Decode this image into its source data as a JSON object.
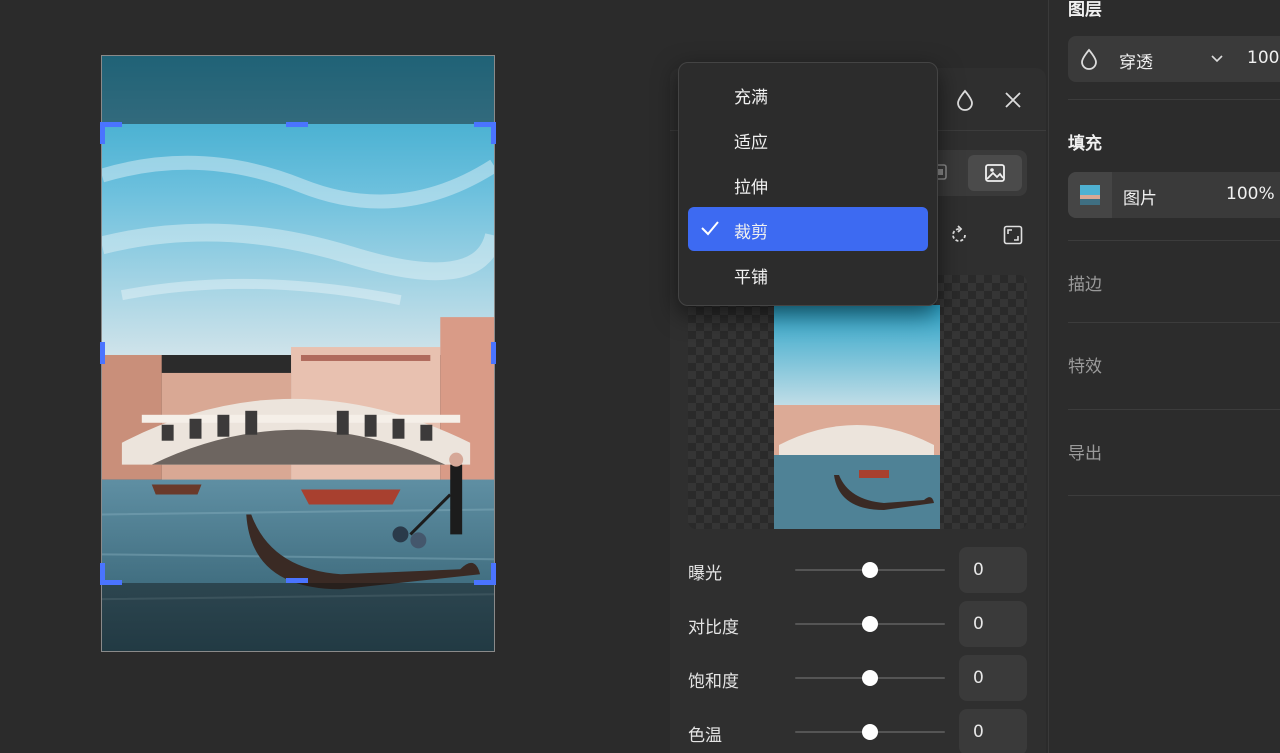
{
  "crop_mode_menu": {
    "items": [
      {
        "label": "充满",
        "selected": false
      },
      {
        "label": "适应",
        "selected": false
      },
      {
        "label": "拉伸",
        "selected": false
      },
      {
        "label": "裁剪",
        "selected": true
      },
      {
        "label": "平铺",
        "selected": false
      }
    ]
  },
  "adjustments": [
    {
      "label": "曝光",
      "value": "0"
    },
    {
      "label": "对比度",
      "value": "0"
    },
    {
      "label": "饱和度",
      "value": "0"
    },
    {
      "label": "色温",
      "value": "0"
    }
  ],
  "sidebar": {
    "layer_title": "图层",
    "blend_mode": "穿透",
    "layer_opacity": "100",
    "fill_title": "填充",
    "fill_type": "图片",
    "fill_opacity": "100%",
    "stroke_title": "描边",
    "effects_title": "特效",
    "export_title": "导出"
  },
  "colors": {
    "accent": "#3d6af2",
    "handle": "#4a74ff",
    "background": "#2b2b2b"
  }
}
